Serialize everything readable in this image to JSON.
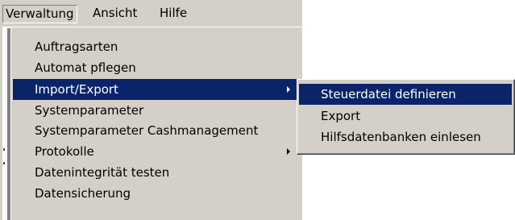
{
  "menubar": {
    "items": [
      {
        "label": "Verwaltung"
      },
      {
        "label": "Ansicht"
      },
      {
        "label": "Hilfe"
      }
    ]
  },
  "dropdown": {
    "items": [
      {
        "label": "Auftragsarten"
      },
      {
        "label": "Automat pflegen"
      },
      {
        "label": "Import/Export"
      },
      {
        "label": "Systemparameter"
      },
      {
        "label": "Systemparameter Cashmanagement"
      },
      {
        "label": "Protokolle"
      },
      {
        "label": "Datenintegrität testen"
      },
      {
        "label": "Datensicherung"
      }
    ]
  },
  "submenu": {
    "items": [
      {
        "label": "Steuerdatei definieren"
      },
      {
        "label": "Export"
      },
      {
        "label": "Hilfsdatenbanken einlesen"
      }
    ]
  },
  "colors": {
    "face": "#d4d0c8",
    "highlight": "#0a246a",
    "highlight_text": "#ffffff"
  }
}
